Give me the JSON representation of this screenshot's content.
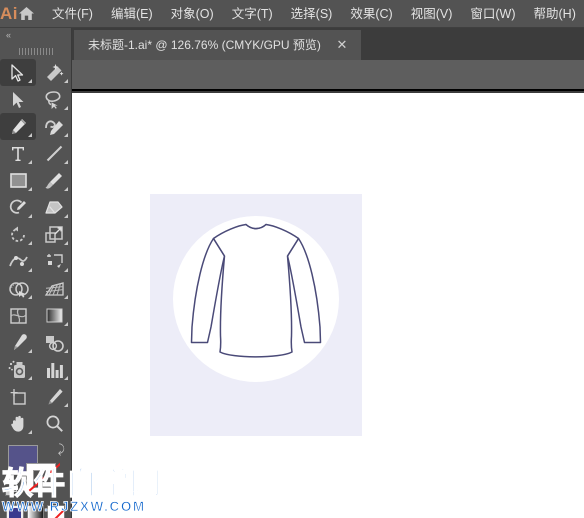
{
  "app": {
    "logo_text": "Ai",
    "home_icon": "home-icon"
  },
  "menubar": {
    "items": [
      {
        "label": "文件(F)"
      },
      {
        "label": "编辑(E)"
      },
      {
        "label": "对象(O)"
      },
      {
        "label": "文字(T)"
      },
      {
        "label": "选择(S)"
      },
      {
        "label": "效果(C)"
      },
      {
        "label": "视图(V)"
      },
      {
        "label": "窗口(W)"
      },
      {
        "label": "帮助(H)"
      }
    ]
  },
  "document_tab": {
    "title": "未标题-1.ai* @ 126.76% (CMYK/GPU 预览)",
    "close_label": "✕",
    "zoom_level": "126.76%",
    "color_mode": "CMYK/GPU 预览",
    "file_name": "未标题-1.ai*"
  },
  "toolpanel": {
    "collapse_label": "«",
    "tools": [
      {
        "name": "selection-tool",
        "active": true
      },
      {
        "name": "magic-wand-tool",
        "active": false
      },
      {
        "name": "direct-selection-tool",
        "active": false
      },
      {
        "name": "lasso-tool",
        "active": false
      },
      {
        "name": "pen-tool",
        "active": true
      },
      {
        "name": "curvature-tool",
        "active": false
      },
      {
        "name": "type-tool",
        "active": false
      },
      {
        "name": "line-segment-tool",
        "active": false
      },
      {
        "name": "rectangle-tool",
        "active": false
      },
      {
        "name": "paintbrush-tool",
        "active": false
      },
      {
        "name": "shaper-tool",
        "active": false
      },
      {
        "name": "eraser-tool",
        "active": false
      },
      {
        "name": "rotate-tool",
        "active": false
      },
      {
        "name": "scale-tool",
        "active": false
      },
      {
        "name": "width-tool",
        "active": false
      },
      {
        "name": "free-transform-tool",
        "active": false
      },
      {
        "name": "shape-builder-tool",
        "active": false
      },
      {
        "name": "perspective-grid-tool",
        "active": false
      },
      {
        "name": "mesh-tool",
        "active": false
      },
      {
        "name": "gradient-tool",
        "active": false
      },
      {
        "name": "eyedropper-tool",
        "active": false
      },
      {
        "name": "blend-tool",
        "active": false
      },
      {
        "name": "symbol-sprayer-tool",
        "active": false
      },
      {
        "name": "column-graph-tool",
        "active": false
      },
      {
        "name": "artboard-tool",
        "active": false
      },
      {
        "name": "slice-tool",
        "active": false
      },
      {
        "name": "hand-tool",
        "active": false
      },
      {
        "name": "zoom-tool",
        "active": false
      }
    ],
    "fill_color": "#55538a",
    "stroke_color": "none",
    "swap_label": "⤸"
  },
  "artwork": {
    "background_color": "#ededf8",
    "circle_color": "#ffffff",
    "stroke_color": "#4a4a78",
    "subject": "long-sleeve-shirt-outline"
  },
  "canvas": {
    "background_color": "#ffffff"
  },
  "watermark": {
    "chinese": "软件自学网",
    "url": "WWW.RJZXW.COM",
    "color": "#1166cc"
  }
}
